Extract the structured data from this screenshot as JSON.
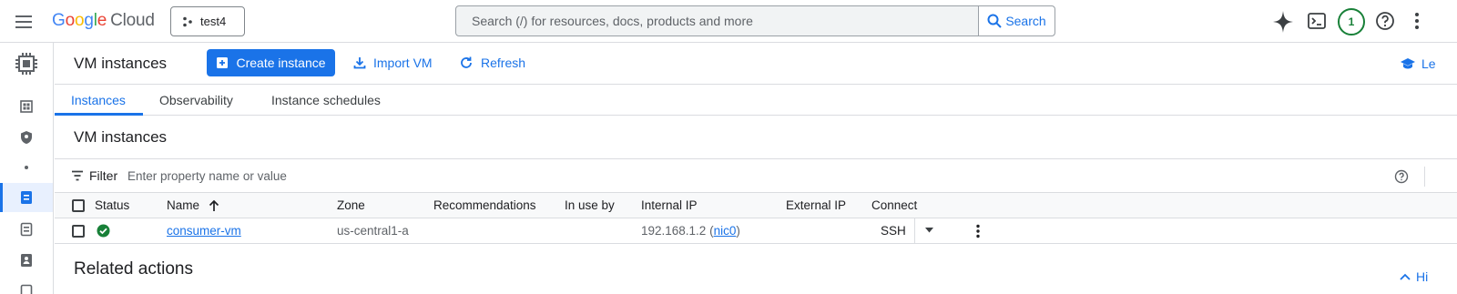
{
  "topbar": {
    "logo_g": [
      "G",
      "o",
      "o",
      "g",
      "l",
      "e"
    ],
    "logo_cloud": "Cloud",
    "project_name": "test4",
    "search_placeholder": "Search (/) for resources, docs, products and more",
    "search_button": "Search",
    "notification_count": "1",
    "icons": [
      "menu-icon",
      "gemini-sparkle-icon",
      "cloud-shell-icon",
      "help-icon",
      "more-vert-icon"
    ]
  },
  "header": {
    "title": "VM instances",
    "create_label": "Create instance",
    "import_label": "Import VM",
    "refresh_label": "Refresh",
    "learn_label": "Le"
  },
  "tabs": [
    {
      "label": "Instances",
      "active": true
    },
    {
      "label": "Observability",
      "active": false
    },
    {
      "label": "Instance schedules",
      "active": false
    }
  ],
  "section": {
    "title": "VM instances",
    "filter_label": "Filter",
    "filter_placeholder": "Enter property name or value"
  },
  "table": {
    "columns": [
      "Status",
      "Name",
      "Zone",
      "Recommendations",
      "In use by",
      "Internal IP",
      "External IP",
      "Connect"
    ],
    "rows": [
      {
        "status": "running",
        "name": "consumer-vm",
        "zone": "us-central1-a",
        "recommendations": "",
        "in_use_by": "",
        "internal_ip": "192.168.1.2",
        "internal_ip_nic_open": " (",
        "internal_ip_nic": "nic0",
        "internal_ip_nic_close": ")",
        "external_ip": "",
        "connect": "SSH"
      }
    ]
  },
  "related": {
    "title": "Related actions",
    "hide_label": "Hi"
  },
  "colors": {
    "primary": "#1a73e8",
    "status_green": "#188038",
    "border": "#dadce0"
  }
}
